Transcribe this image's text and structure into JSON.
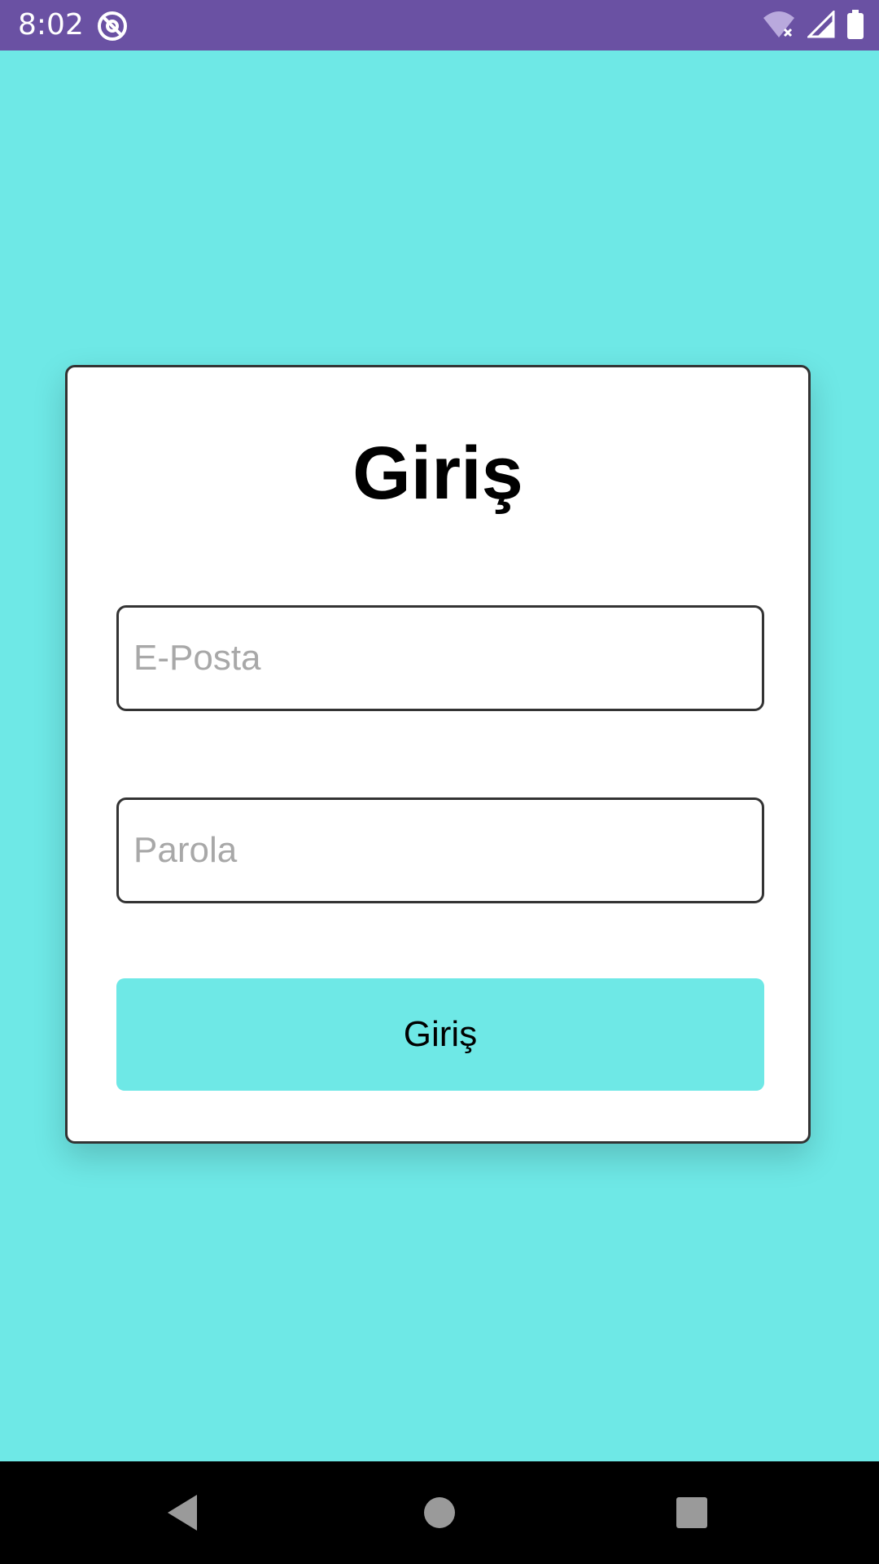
{
  "status_bar": {
    "time": "8:02",
    "background_color": "#6a51a3",
    "icons": [
      "at-sign-icon",
      "wifi-off-icon",
      "signal-icon",
      "battery-icon"
    ]
  },
  "background_color": "#6ee8e6",
  "login_card": {
    "title": "Giriş",
    "email_field": {
      "placeholder": "E-Posta",
      "value": ""
    },
    "password_field": {
      "placeholder": "Parola",
      "value": ""
    },
    "submit_label": "Giriş",
    "button_color": "#6ee8e6"
  },
  "nav_bar": {
    "icons": [
      "back-icon",
      "home-icon",
      "recents-icon"
    ]
  }
}
